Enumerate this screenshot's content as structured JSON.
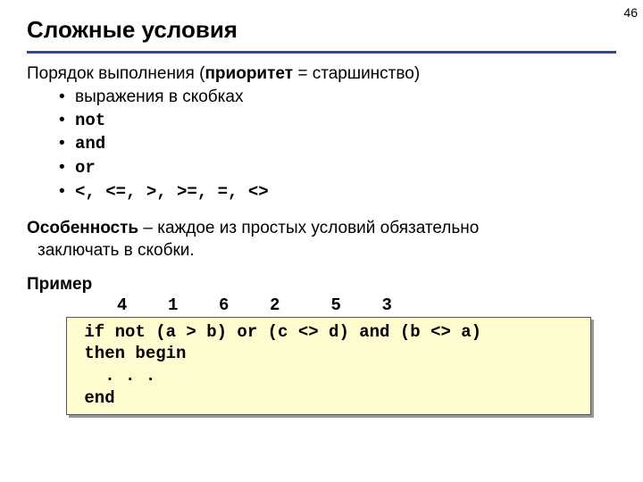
{
  "page_number": "46",
  "title": "Сложные условия",
  "subhead_prefix": "Порядок выполнения (",
  "subhead_bold": "приоритет",
  "subhead_suffix": " = старшинство)",
  "bullets": [
    {
      "text": "выражения в скобках",
      "mono": false
    },
    {
      "text": "not",
      "mono": true
    },
    {
      "text": "and",
      "mono": true
    },
    {
      "text": "or",
      "mono": true
    },
    {
      "text": "<, <=, >, >=, =, <>",
      "mono": true
    }
  ],
  "feature_bold": "Особенность",
  "feature_rest_line1": " – каждое из простых условий обязательно",
  "feature_line2": "заключать в скобки.",
  "example_label": "Пример",
  "annotations": "     4    1    6    2     5    3",
  "code": " if not (a > b) or (c <> d) and (b <> a)\n then begin\n   . . .\n end"
}
